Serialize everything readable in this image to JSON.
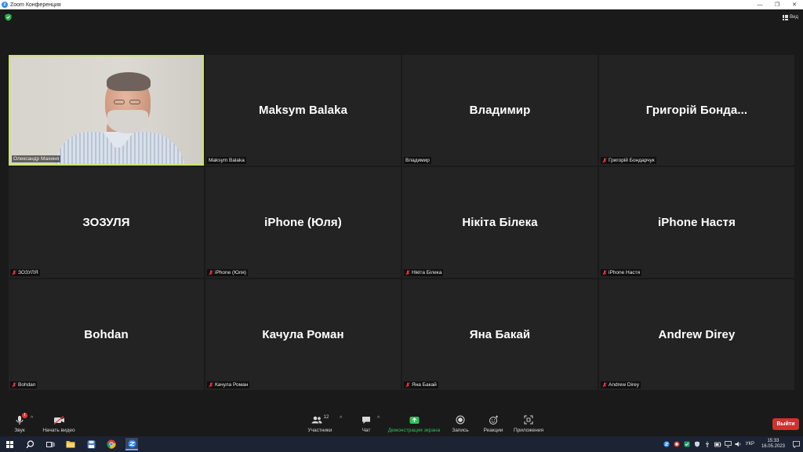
{
  "window": {
    "title": "Zoom Конференция",
    "minimize": "—",
    "maximize": "❐",
    "close": "✕"
  },
  "topbar": {
    "view_label": "Вид"
  },
  "participants": [
    {
      "big": "",
      "name": "Олександр Махиня",
      "muted": false,
      "video": true,
      "active": true
    },
    {
      "big": "Maksym Balaka",
      "name": "Maksym Balaka",
      "muted": false
    },
    {
      "big": "Владимир",
      "name": "Владимир",
      "muted": false
    },
    {
      "big": "Григорій  Бонда...",
      "name": "Григорій Бондарчук",
      "muted": true
    },
    {
      "big": "ЗОЗУЛЯ",
      "name": "ЗОЗУЛЯ",
      "muted": true
    },
    {
      "big": "iPhone (Юля)",
      "name": "iPhone (Юля)",
      "muted": true
    },
    {
      "big": "Нікіта Білека",
      "name": "Нікіта Білека",
      "muted": true
    },
    {
      "big": "iPhone Настя",
      "name": "iPhone Настя",
      "muted": true
    },
    {
      "big": "Bohdan",
      "name": "Bohdan",
      "muted": true
    },
    {
      "big": "Качула Роман",
      "name": "Качула Роман",
      "muted": true
    },
    {
      "big": "Яна Бакай",
      "name": "Яна Бакай",
      "muted": true
    },
    {
      "big": "Andrew Direy",
      "name": "Andrew Direy",
      "muted": true
    }
  ],
  "toolbar": {
    "audio_label": "Звук",
    "audio_badge": "!",
    "video_label": "Начать видео",
    "participants_label": "Участники",
    "participants_count": "12",
    "chat_label": "Чат",
    "share_label": "Демонстрация экрана",
    "record_label": "Запись",
    "reactions_label": "Реакции",
    "apps_label": "Приложения",
    "leave_label": "Выйти"
  },
  "taskbar": {
    "language": "УКР",
    "time": "15:33",
    "date": "16.05.2023"
  },
  "colors": {
    "active_speaker_border": "#c9e36d",
    "share_green": "#2fc057",
    "leave_red": "#d32f2f",
    "zoom_blue": "#2d8cff"
  }
}
